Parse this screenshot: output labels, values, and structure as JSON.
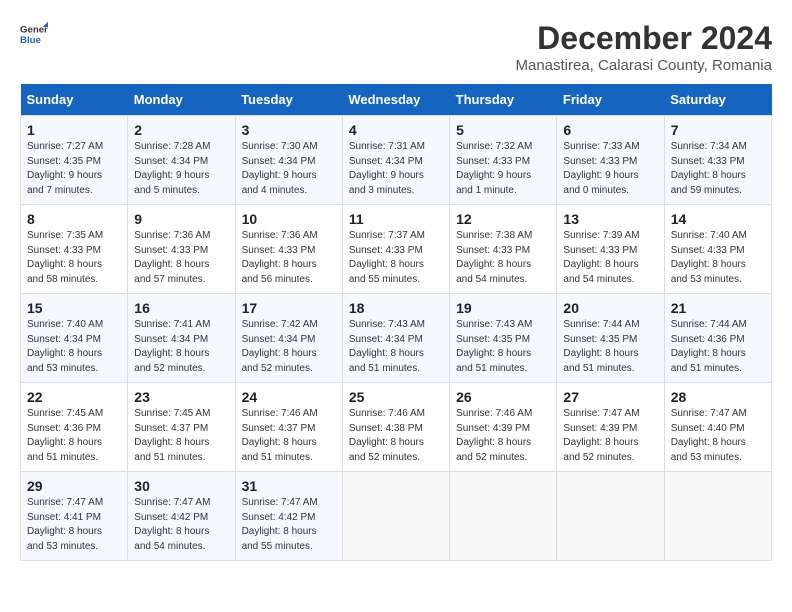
{
  "logo": {
    "general": "General",
    "blue": "Blue"
  },
  "title": "December 2024",
  "subtitle": "Manastirea, Calarasi County, Romania",
  "days_header": [
    "Sunday",
    "Monday",
    "Tuesday",
    "Wednesday",
    "Thursday",
    "Friday",
    "Saturday"
  ],
  "weeks": [
    [
      {
        "day": "1",
        "sunrise": "7:27 AM",
        "sunset": "4:35 PM",
        "daylight": "9 hours and 7 minutes."
      },
      {
        "day": "2",
        "sunrise": "7:28 AM",
        "sunset": "4:34 PM",
        "daylight": "9 hours and 5 minutes."
      },
      {
        "day": "3",
        "sunrise": "7:30 AM",
        "sunset": "4:34 PM",
        "daylight": "9 hours and 4 minutes."
      },
      {
        "day": "4",
        "sunrise": "7:31 AM",
        "sunset": "4:34 PM",
        "daylight": "9 hours and 3 minutes."
      },
      {
        "day": "5",
        "sunrise": "7:32 AM",
        "sunset": "4:33 PM",
        "daylight": "9 hours and 1 minute."
      },
      {
        "day": "6",
        "sunrise": "7:33 AM",
        "sunset": "4:33 PM",
        "daylight": "9 hours and 0 minutes."
      },
      {
        "day": "7",
        "sunrise": "7:34 AM",
        "sunset": "4:33 PM",
        "daylight": "8 hours and 59 minutes."
      }
    ],
    [
      {
        "day": "8",
        "sunrise": "7:35 AM",
        "sunset": "4:33 PM",
        "daylight": "8 hours and 58 minutes."
      },
      {
        "day": "9",
        "sunrise": "7:36 AM",
        "sunset": "4:33 PM",
        "daylight": "8 hours and 57 minutes."
      },
      {
        "day": "10",
        "sunrise": "7:36 AM",
        "sunset": "4:33 PM",
        "daylight": "8 hours and 56 minutes."
      },
      {
        "day": "11",
        "sunrise": "7:37 AM",
        "sunset": "4:33 PM",
        "daylight": "8 hours and 55 minutes."
      },
      {
        "day": "12",
        "sunrise": "7:38 AM",
        "sunset": "4:33 PM",
        "daylight": "8 hours and 54 minutes."
      },
      {
        "day": "13",
        "sunrise": "7:39 AM",
        "sunset": "4:33 PM",
        "daylight": "8 hours and 54 minutes."
      },
      {
        "day": "14",
        "sunrise": "7:40 AM",
        "sunset": "4:33 PM",
        "daylight": "8 hours and 53 minutes."
      }
    ],
    [
      {
        "day": "15",
        "sunrise": "7:40 AM",
        "sunset": "4:34 PM",
        "daylight": "8 hours and 53 minutes."
      },
      {
        "day": "16",
        "sunrise": "7:41 AM",
        "sunset": "4:34 PM",
        "daylight": "8 hours and 52 minutes."
      },
      {
        "day": "17",
        "sunrise": "7:42 AM",
        "sunset": "4:34 PM",
        "daylight": "8 hours and 52 minutes."
      },
      {
        "day": "18",
        "sunrise": "7:43 AM",
        "sunset": "4:34 PM",
        "daylight": "8 hours and 51 minutes."
      },
      {
        "day": "19",
        "sunrise": "7:43 AM",
        "sunset": "4:35 PM",
        "daylight": "8 hours and 51 minutes."
      },
      {
        "day": "20",
        "sunrise": "7:44 AM",
        "sunset": "4:35 PM",
        "daylight": "8 hours and 51 minutes."
      },
      {
        "day": "21",
        "sunrise": "7:44 AM",
        "sunset": "4:36 PM",
        "daylight": "8 hours and 51 minutes."
      }
    ],
    [
      {
        "day": "22",
        "sunrise": "7:45 AM",
        "sunset": "4:36 PM",
        "daylight": "8 hours and 51 minutes."
      },
      {
        "day": "23",
        "sunrise": "7:45 AM",
        "sunset": "4:37 PM",
        "daylight": "8 hours and 51 minutes."
      },
      {
        "day": "24",
        "sunrise": "7:46 AM",
        "sunset": "4:37 PM",
        "daylight": "8 hours and 51 minutes."
      },
      {
        "day": "25",
        "sunrise": "7:46 AM",
        "sunset": "4:38 PM",
        "daylight": "8 hours and 52 minutes."
      },
      {
        "day": "26",
        "sunrise": "7:46 AM",
        "sunset": "4:39 PM",
        "daylight": "8 hours and 52 minutes."
      },
      {
        "day": "27",
        "sunrise": "7:47 AM",
        "sunset": "4:39 PM",
        "daylight": "8 hours and 52 minutes."
      },
      {
        "day": "28",
        "sunrise": "7:47 AM",
        "sunset": "4:40 PM",
        "daylight": "8 hours and 53 minutes."
      }
    ],
    [
      {
        "day": "29",
        "sunrise": "7:47 AM",
        "sunset": "4:41 PM",
        "daylight": "8 hours and 53 minutes."
      },
      {
        "day": "30",
        "sunrise": "7:47 AM",
        "sunset": "4:42 PM",
        "daylight": "8 hours and 54 minutes."
      },
      {
        "day": "31",
        "sunrise": "7:47 AM",
        "sunset": "4:42 PM",
        "daylight": "8 hours and 55 minutes."
      },
      null,
      null,
      null,
      null
    ]
  ],
  "labels": {
    "sunrise": "Sunrise:",
    "sunset": "Sunset:",
    "daylight": "Daylight:"
  }
}
